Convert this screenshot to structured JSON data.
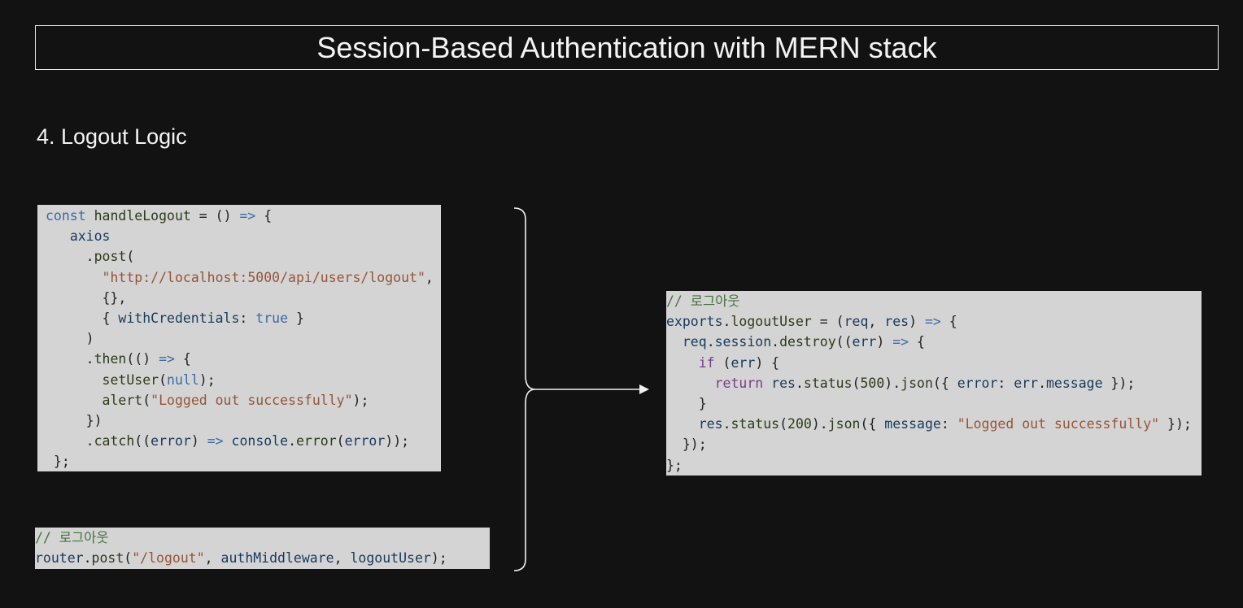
{
  "title": "Session-Based Authentication with MERN stack",
  "section_heading": "4. Logout Logic",
  "frontend_code": [
    [
      [
        "kw",
        "const "
      ],
      [
        "fn",
        "handleLogout"
      ],
      [
        "pu",
        " = () "
      ],
      [
        "kw",
        "=>"
      ],
      [
        "pu",
        " {"
      ]
    ],
    [
      [
        "pu",
        "   "
      ],
      [
        "id",
        "axios"
      ]
    ],
    [
      [
        "pu",
        "     ."
      ],
      [
        "fn",
        "post"
      ],
      [
        "pu",
        "("
      ]
    ],
    [
      [
        "pu",
        "       "
      ],
      [
        "str",
        "\"http://localhost:5000/api/users/logout\""
      ],
      [
        "pu",
        ","
      ]
    ],
    [
      [
        "pu",
        "       {},"
      ]
    ],
    [
      [
        "pu",
        "       { "
      ],
      [
        "id",
        "withCredentials"
      ],
      [
        "pu",
        ": "
      ],
      [
        "kw",
        "true"
      ],
      [
        "pu",
        " }"
      ]
    ],
    [
      [
        "pu",
        "     )"
      ]
    ],
    [
      [
        "pu",
        "     ."
      ],
      [
        "fn",
        "then"
      ],
      [
        "pu",
        "(() "
      ],
      [
        "kw",
        "=>"
      ],
      [
        "pu",
        " {"
      ]
    ],
    [
      [
        "pu",
        "       "
      ],
      [
        "fn",
        "setUser"
      ],
      [
        "pu",
        "("
      ],
      [
        "kw",
        "null"
      ],
      [
        "pu",
        ");"
      ]
    ],
    [
      [
        "pu",
        "       "
      ],
      [
        "fn",
        "alert"
      ],
      [
        "pu",
        "("
      ],
      [
        "str",
        "\"Logged out successfully\""
      ],
      [
        "pu",
        ");"
      ]
    ],
    [
      [
        "pu",
        "     })"
      ]
    ],
    [
      [
        "pu",
        "     ."
      ],
      [
        "fn",
        "catch"
      ],
      [
        "pu",
        "(("
      ],
      [
        "id",
        "error"
      ],
      [
        "pu",
        ") "
      ],
      [
        "kw",
        "=>"
      ],
      [
        "pu",
        " "
      ],
      [
        "id",
        "console"
      ],
      [
        "pu",
        "."
      ],
      [
        "fn",
        "error"
      ],
      [
        "pu",
        "("
      ],
      [
        "id",
        "error"
      ],
      [
        "pu",
        "));"
      ]
    ],
    [
      [
        "pu",
        " };"
      ]
    ]
  ],
  "route_code": [
    [
      [
        "cm",
        "// 로그아웃"
      ]
    ],
    [
      [
        "id",
        "router"
      ],
      [
        "pu",
        "."
      ],
      [
        "fn",
        "post"
      ],
      [
        "pu",
        "("
      ],
      [
        "str",
        "\"/logout\""
      ],
      [
        "pu",
        ", "
      ],
      [
        "id",
        "authMiddleware"
      ],
      [
        "pu",
        ", "
      ],
      [
        "id",
        "logoutUser"
      ],
      [
        "pu",
        ");"
      ]
    ]
  ],
  "controller_code": [
    [
      [
        "cm",
        "// 로그아웃"
      ]
    ],
    [
      [
        "id",
        "exports"
      ],
      [
        "pu",
        "."
      ],
      [
        "fn",
        "logoutUser"
      ],
      [
        "pu",
        " = ("
      ],
      [
        "id",
        "req"
      ],
      [
        "pu",
        ", "
      ],
      [
        "id",
        "res"
      ],
      [
        "pu",
        ") "
      ],
      [
        "kw",
        "=>"
      ],
      [
        "pu",
        " {"
      ]
    ],
    [
      [
        "pu",
        "  "
      ],
      [
        "id",
        "req"
      ],
      [
        "pu",
        "."
      ],
      [
        "id",
        "session"
      ],
      [
        "pu",
        "."
      ],
      [
        "fn",
        "destroy"
      ],
      [
        "pu",
        "(("
      ],
      [
        "id",
        "err"
      ],
      [
        "pu",
        ") "
      ],
      [
        "kw",
        "=>"
      ],
      [
        "pu",
        " {"
      ]
    ],
    [
      [
        "pu",
        "    "
      ],
      [
        "ctl",
        "if"
      ],
      [
        "pu",
        " ("
      ],
      [
        "id",
        "err"
      ],
      [
        "pu",
        ") {"
      ]
    ],
    [
      [
        "pu",
        "      "
      ],
      [
        "ctl",
        "return"
      ],
      [
        "pu",
        " "
      ],
      [
        "id",
        "res"
      ],
      [
        "pu",
        "."
      ],
      [
        "fn",
        "status"
      ],
      [
        "pu",
        "("
      ],
      [
        "num",
        "500"
      ],
      [
        "pu",
        ")."
      ],
      [
        "fn",
        "json"
      ],
      [
        "pu",
        "({ "
      ],
      [
        "id",
        "error"
      ],
      [
        "pu",
        ": "
      ],
      [
        "id",
        "err"
      ],
      [
        "pu",
        "."
      ],
      [
        "id",
        "message"
      ],
      [
        "pu",
        " });"
      ]
    ],
    [
      [
        "pu",
        "    }"
      ]
    ],
    [
      [
        "pu",
        "    "
      ],
      [
        "id",
        "res"
      ],
      [
        "pu",
        "."
      ],
      [
        "fn",
        "status"
      ],
      [
        "pu",
        "("
      ],
      [
        "num",
        "200"
      ],
      [
        "pu",
        ")."
      ],
      [
        "fn",
        "json"
      ],
      [
        "pu",
        "({ "
      ],
      [
        "id",
        "message"
      ],
      [
        "pu",
        ": "
      ],
      [
        "str",
        "\"Logged out successfully\""
      ],
      [
        "pu",
        " });"
      ]
    ],
    [
      [
        "pu",
        "  });"
      ]
    ],
    [
      [
        "pu",
        "};"
      ]
    ]
  ]
}
